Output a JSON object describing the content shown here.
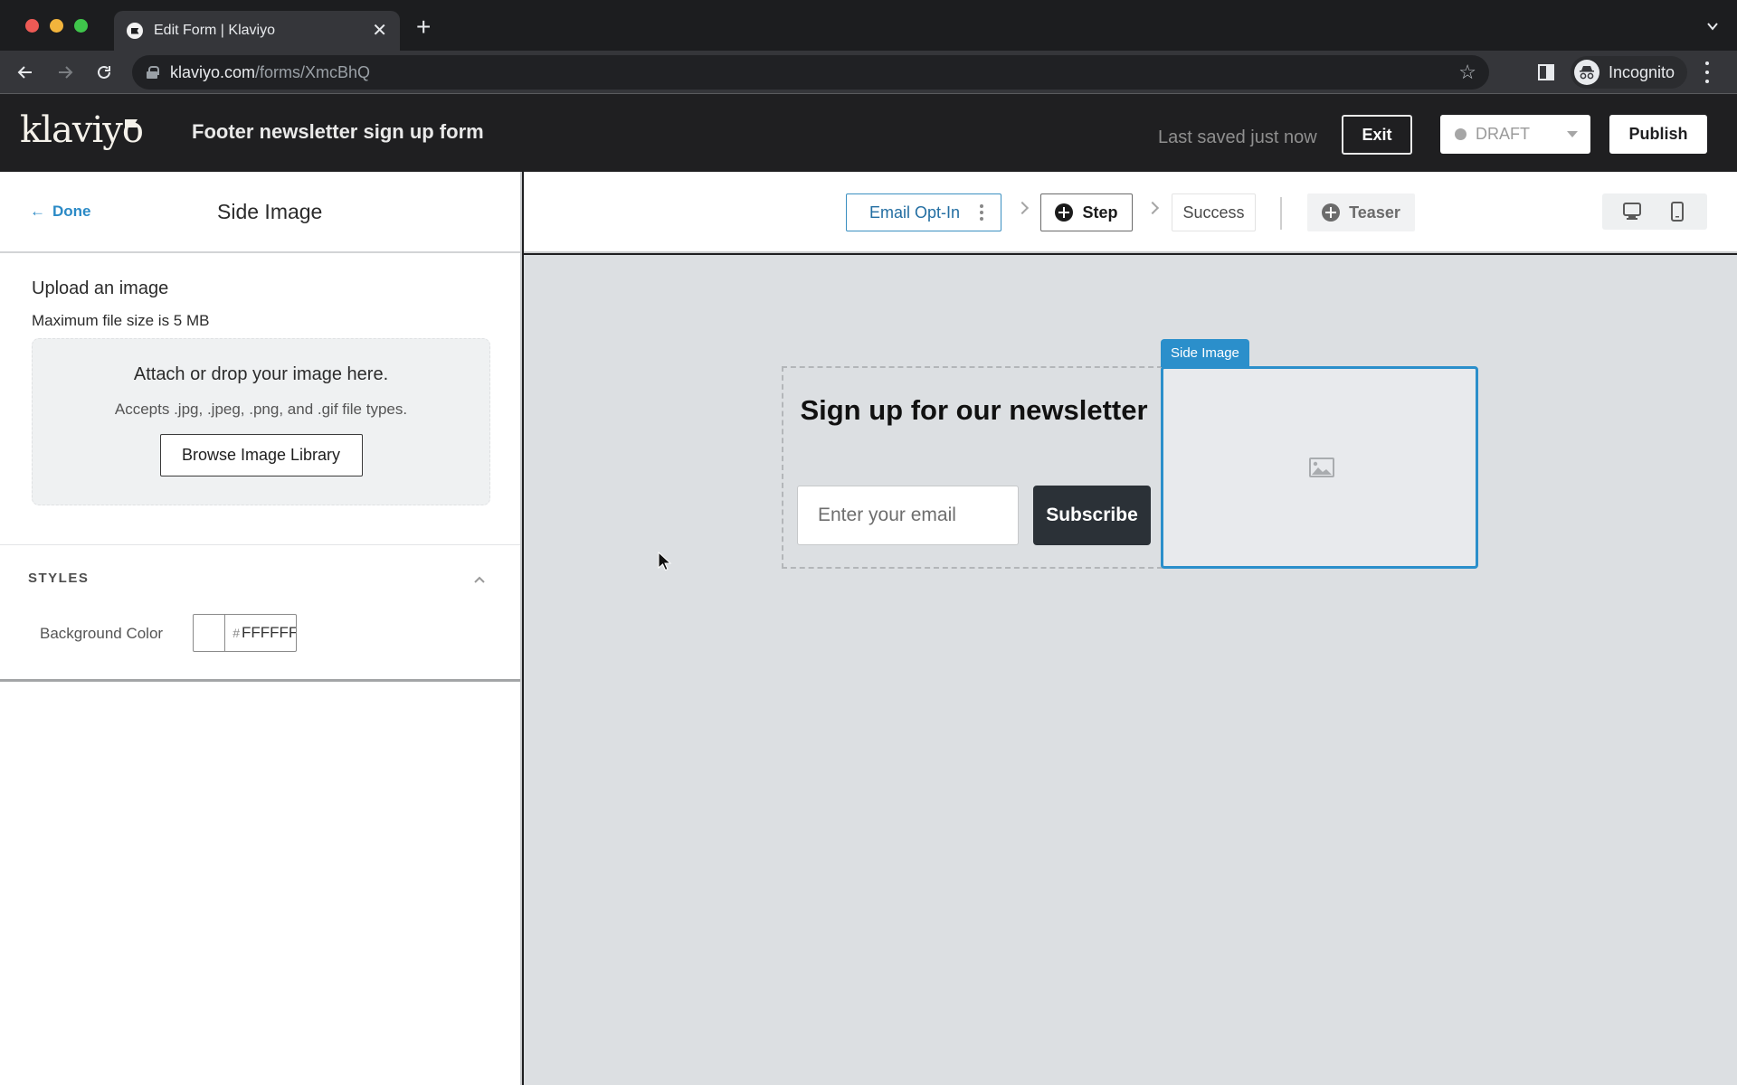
{
  "browser": {
    "tab_title": "Edit Form | Klaviyo",
    "url_host": "klaviyo.com",
    "url_path": "/forms/XmcBhQ",
    "profile_label": "Incognito"
  },
  "header": {
    "logo": "klaviyo",
    "form_title": "Footer newsletter sign up form",
    "last_saved": "Last saved just now",
    "exit_label": "Exit",
    "status": "DRAFT",
    "publish_label": "Publish"
  },
  "left_panel": {
    "done_label": "Done",
    "title": "Side Image",
    "upload_heading": "Upload an image",
    "max_size": "Maximum file size is 5 MB",
    "drop_title": "Attach or drop your image here.",
    "drop_subtitle": "Accepts .jpg, .jpeg, .png, and .gif file types.",
    "browse_label": "Browse Image Library",
    "styles_label": "STYLES",
    "bg_color_label": "Background Color",
    "bg_color_hash": "#",
    "bg_color_value": "FFFFFF"
  },
  "steps": {
    "items": [
      {
        "label": "Email Opt-In",
        "state": "selected"
      },
      {
        "label": "Step",
        "state": "add"
      },
      {
        "label": "Success",
        "state": "default"
      }
    ],
    "teaser_label": "Teaser"
  },
  "canvas": {
    "heading": "Sign up for our newsletter",
    "email_placeholder": "Enter your email",
    "subscribe_label": "Subscribe",
    "side_image_tab": "Side Image"
  },
  "colors": {
    "accent": "#2B8FCB",
    "header_bg": "#1F1F21",
    "canvas_bg": "#DCDFE2",
    "subscribe_bg": "#2B3137"
  }
}
